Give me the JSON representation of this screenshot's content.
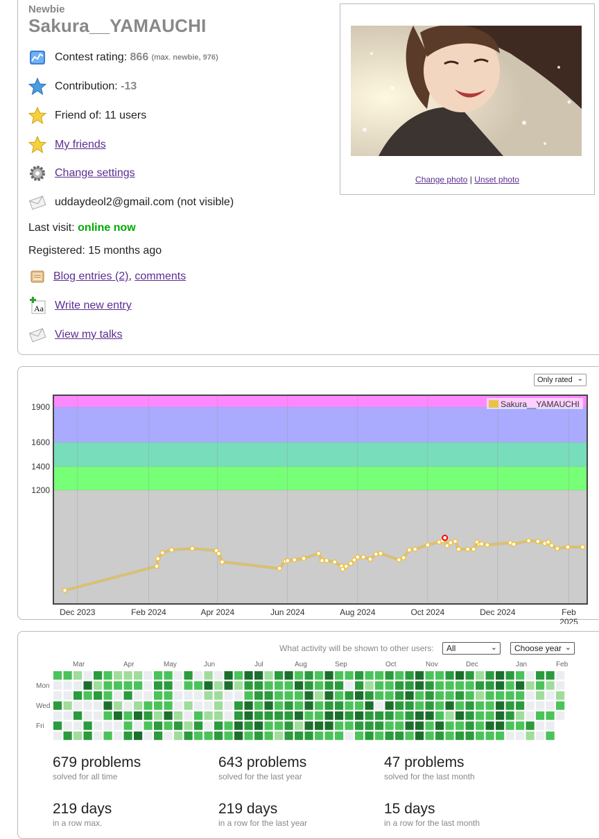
{
  "profile": {
    "rank": "Newbie",
    "handle": "Sakura__YAMAUCHI",
    "contest_rating_label": "Contest rating:",
    "contest_rating_value": "866",
    "max_open": "(max.",
    "max_rank": "newbie, 976",
    "max_close": ")",
    "contribution_label": "Contribution:",
    "contribution_value": "-13",
    "friend_of": "Friend of: 11 users",
    "my_friends": "My friends",
    "change_settings": "Change settings",
    "email": "uddaydeol2@gmail.com (not visible)",
    "last_visit_label": "Last visit:",
    "last_visit_value": "online now",
    "registered": "Registered: 15 months ago",
    "blog_entries": "Blog entries (2)",
    "comments": "comments",
    "write_new_entry": "Write new entry",
    "view_my_talks": "View my talks",
    "change_photo": "Change photo",
    "unset_photo": "Unset photo",
    "photo_separator": "|"
  },
  "rating_chart": {
    "filter_selected": "Only rated",
    "legend": "Sakura__YAMAUCHI",
    "colors": {
      "line": "#edc240",
      "highlight": "#ff0000",
      "gray_band": "#cccccc",
      "green_band": "#77ff77",
      "cyan_band": "#77ddbb",
      "blue_band": "#aaaaff",
      "violet_band": "#ff88ff"
    }
  },
  "chart_data": {
    "type": "line",
    "y_tick_labels": [
      "1200",
      "1400",
      "1600",
      "1900"
    ],
    "x_tick_labels": [
      "Dec 2023",
      "Feb 2024",
      "Apr 2024",
      "Jun 2024",
      "Aug 2024",
      "Oct 2024",
      "Dec 2024",
      "Feb 2025"
    ],
    "x_range": [
      "2023-11-10",
      "2025-02-17"
    ],
    "y_range": [
      400,
      2000
    ],
    "rating_bands": [
      {
        "from": 400,
        "to": 1200,
        "color": "#cccccc"
      },
      {
        "from": 1200,
        "to": 1400,
        "color": "#77ff77"
      },
      {
        "from": 1400,
        "to": 1600,
        "color": "#77ddbb"
      },
      {
        "from": 1600,
        "to": 1900,
        "color": "#aaaaff"
      },
      {
        "from": 1900,
        "to": 2000,
        "color": "#ff88ff"
      }
    ],
    "series": [
      {
        "name": "Sakura__YAMAUCHI",
        "points": [
          [
            "2023-11-20",
            495
          ],
          [
            "2024-02-08",
            665
          ],
          [
            "2024-02-09",
            719
          ],
          [
            "2024-02-13",
            760
          ],
          [
            "2024-02-21",
            780
          ],
          [
            "2024-03-10",
            790
          ],
          [
            "2024-03-31",
            775
          ],
          [
            "2024-04-02",
            755
          ],
          [
            "2024-04-05",
            695
          ],
          [
            "2024-05-25",
            650
          ],
          [
            "2024-05-30",
            700
          ],
          [
            "2024-06-01",
            705
          ],
          [
            "2024-06-07",
            710
          ],
          [
            "2024-06-15",
            720
          ],
          [
            "2024-06-28",
            755
          ],
          [
            "2024-07-01",
            705
          ],
          [
            "2024-07-05",
            705
          ],
          [
            "2024-07-12",
            695
          ],
          [
            "2024-07-18",
            665
          ],
          [
            "2024-07-19",
            645
          ],
          [
            "2024-07-22",
            665
          ],
          [
            "2024-07-26",
            685
          ],
          [
            "2024-07-29",
            710
          ],
          [
            "2024-08-01",
            730
          ],
          [
            "2024-08-06",
            730
          ],
          [
            "2024-08-12",
            715
          ],
          [
            "2024-08-17",
            750
          ],
          [
            "2024-08-21",
            755
          ],
          [
            "2024-09-06",
            710
          ],
          [
            "2024-09-10",
            725
          ],
          [
            "2024-09-15",
            780
          ],
          [
            "2024-09-20",
            785
          ],
          [
            "2024-10-01",
            815
          ],
          [
            "2024-10-11",
            835
          ],
          [
            "2024-10-14",
            845
          ],
          [
            "2024-10-16",
            865
          ],
          [
            "2024-10-18",
            810
          ],
          [
            "2024-10-21",
            830
          ],
          [
            "2024-10-25",
            840
          ],
          [
            "2024-10-28",
            785
          ],
          [
            "2024-11-05",
            785
          ],
          [
            "2024-11-10",
            785
          ],
          [
            "2024-11-13",
            835
          ],
          [
            "2024-11-15",
            820
          ],
          [
            "2024-11-17",
            822
          ],
          [
            "2024-11-22",
            815
          ],
          [
            "2024-12-12",
            830
          ],
          [
            "2024-12-15",
            820
          ],
          [
            "2024-12-28",
            845
          ],
          [
            "2025-01-05",
            840
          ],
          [
            "2025-01-11",
            826
          ],
          [
            "2025-01-14",
            835
          ],
          [
            "2025-01-17",
            812
          ],
          [
            "2025-01-22",
            790
          ],
          [
            "2025-01-31",
            800
          ],
          [
            "2025-02-13",
            800
          ]
        ],
        "highlight_point": [
          "2024-10-16",
          865
        ]
      }
    ]
  },
  "activity": {
    "visibility_label": "What activity will be shown to other users:",
    "visibility_selected": "All",
    "year_selected": "Choose year",
    "months": [
      "Mar",
      "Apr",
      "May",
      "Jun",
      "Jul",
      "Aug",
      "Sep",
      "Oct",
      "Nov",
      "Dec",
      "Jan",
      "Feb"
    ],
    "days": [
      "Mon",
      "Wed",
      "Fri"
    ],
    "level_colors": [
      "#ebedf0",
      "#a0dc9b",
      "#4bc35a",
      "#2b9b3d",
      "#1c6e2d"
    ],
    "stats": [
      {
        "value": "679 problems",
        "label": "solved for all time"
      },
      {
        "value": "643 problems",
        "label": "solved for the last year"
      },
      {
        "value": "47 problems",
        "label": "solved for the last month"
      },
      {
        "value": "219 days",
        "label": "in a row max."
      },
      {
        "value": "219 days",
        "label": "in a row for the last year"
      },
      {
        "value": "15 days",
        "label": "in a row for the last month"
      }
    ]
  }
}
